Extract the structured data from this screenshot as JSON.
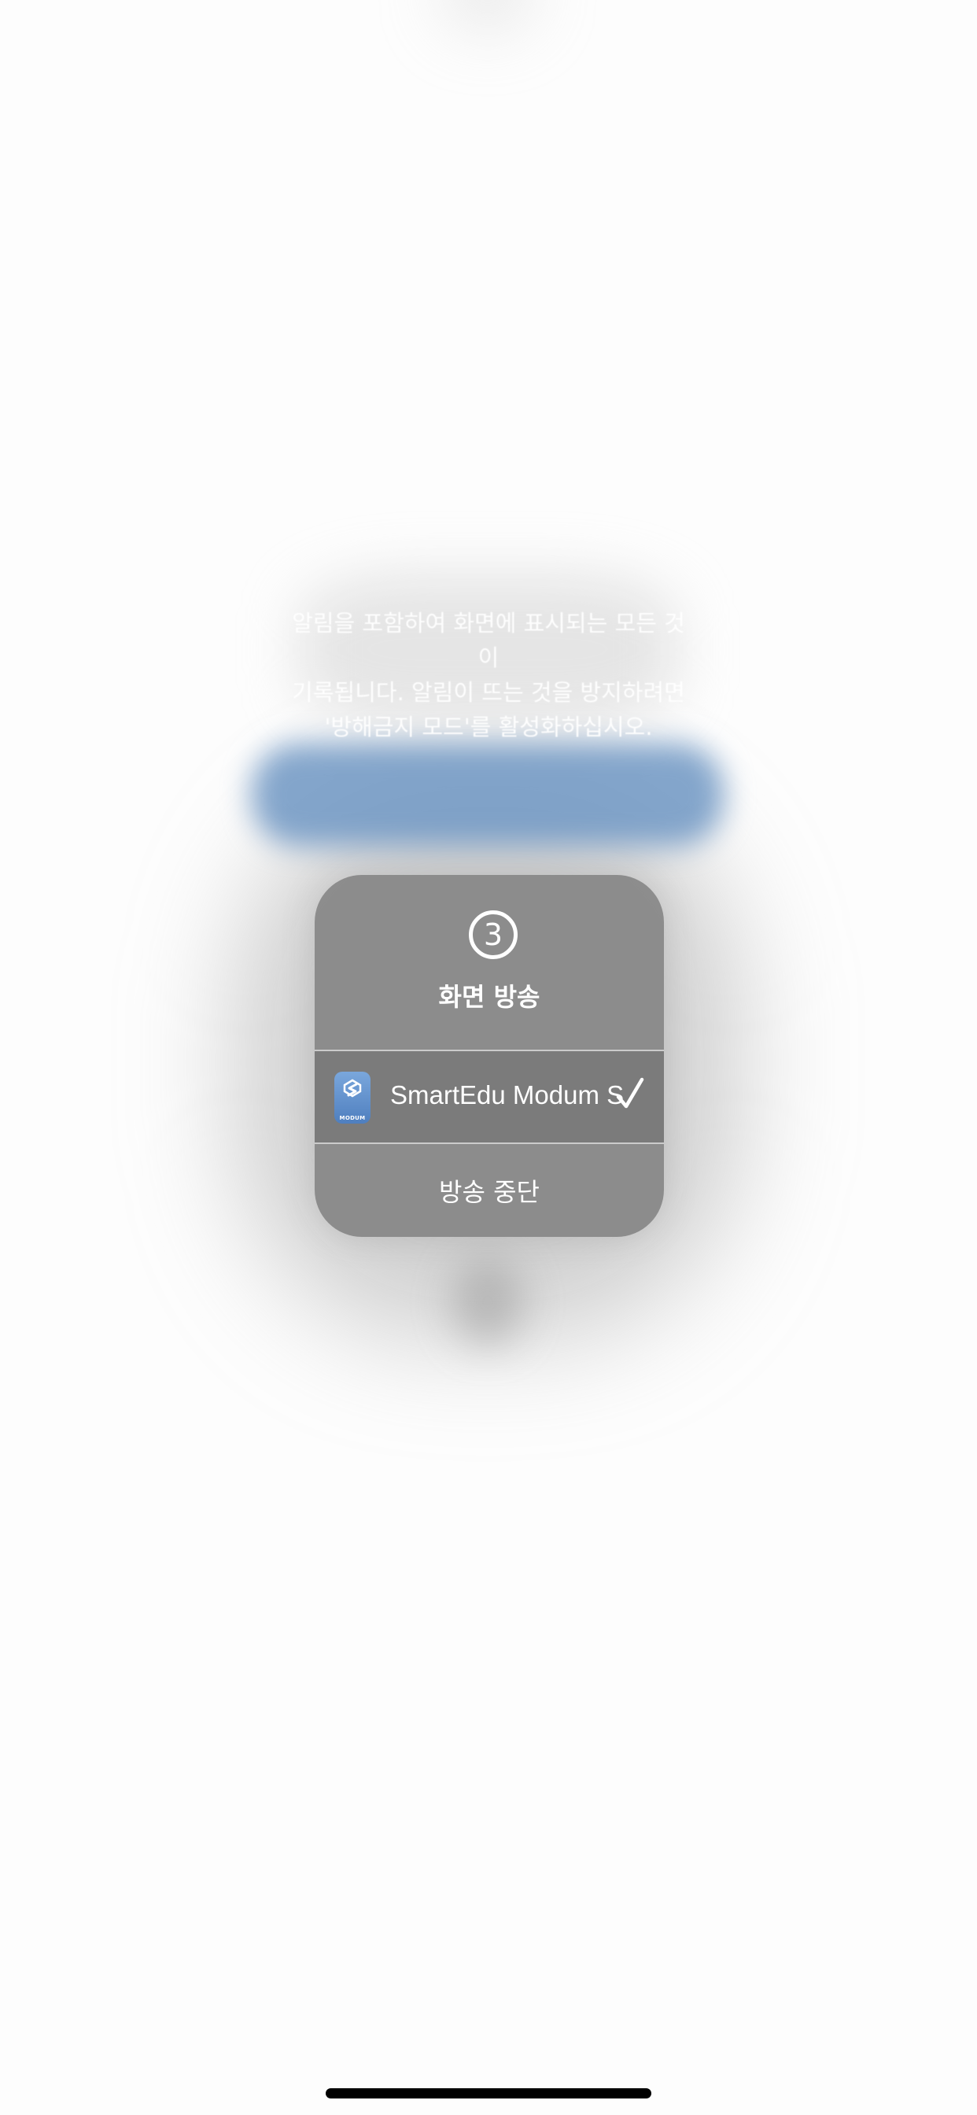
{
  "notice": {
    "line1": "알림을 포함하여 화면에 표시되는 모든 것이",
    "line2": "기록됩니다. 알림이 뜨는 것을 방지하려면",
    "line3": "'방해금지 모드'를 활성화하십시오."
  },
  "menu": {
    "icon": "record-icon",
    "icon_text": "3",
    "title": "화면 방송",
    "app": {
      "name": "SmartEdu Modum S",
      "icon": "smartedu-app-icon",
      "icon_label": "MODUM",
      "selected": true,
      "check_icon": "checkmark-icon"
    },
    "stop_label": "방송 중단"
  },
  "colors": {
    "panel": "#878787",
    "selected_row": "#6e6e6e",
    "accent_blue": "#6e96c3"
  }
}
